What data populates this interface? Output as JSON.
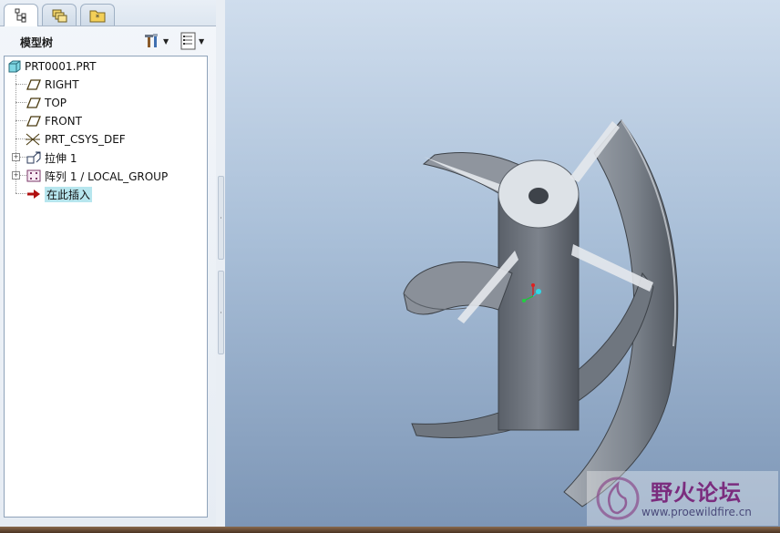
{
  "model_tree": {
    "title": "模型树",
    "nodes": [
      {
        "label": "PRT0001.PRT",
        "icon": "part-icon"
      },
      {
        "label": "RIGHT",
        "icon": "datum-plane-icon"
      },
      {
        "label": "TOP",
        "icon": "datum-plane-icon"
      },
      {
        "label": "FRONT",
        "icon": "datum-plane-icon"
      },
      {
        "label": "PRT_CSYS_DEF",
        "icon": "coordinate-system-icon"
      },
      {
        "label": "拉伸 1",
        "icon": "extrude-icon",
        "expandable": true
      },
      {
        "label": "阵列 1 / LOCAL_GROUP",
        "icon": "pattern-icon",
        "expandable": true
      },
      {
        "label": "在此插入",
        "icon": "insert-here-arrow-icon",
        "highlighted": true
      }
    ]
  },
  "tabs": [
    {
      "name": "model-tree-tab",
      "icon": "tree-icon",
      "active": true
    },
    {
      "name": "layers-tab",
      "icon": "layers-icon",
      "active": false
    },
    {
      "name": "favorites-tab",
      "icon": "folder-star-icon",
      "active": false
    }
  ],
  "toolbar": {
    "settings_icon": "tools-icon",
    "show_icon": "list-icon"
  },
  "watermark": {
    "title": "野火论坛",
    "url": "www.proewildfire.cn"
  },
  "colors": {
    "viewport_top": "#cfdded",
    "viewport_bottom": "#7d96b6",
    "part_gray": "#8c9199",
    "highlight": "#b7e6ee",
    "insert_arrow": "#b01010"
  }
}
